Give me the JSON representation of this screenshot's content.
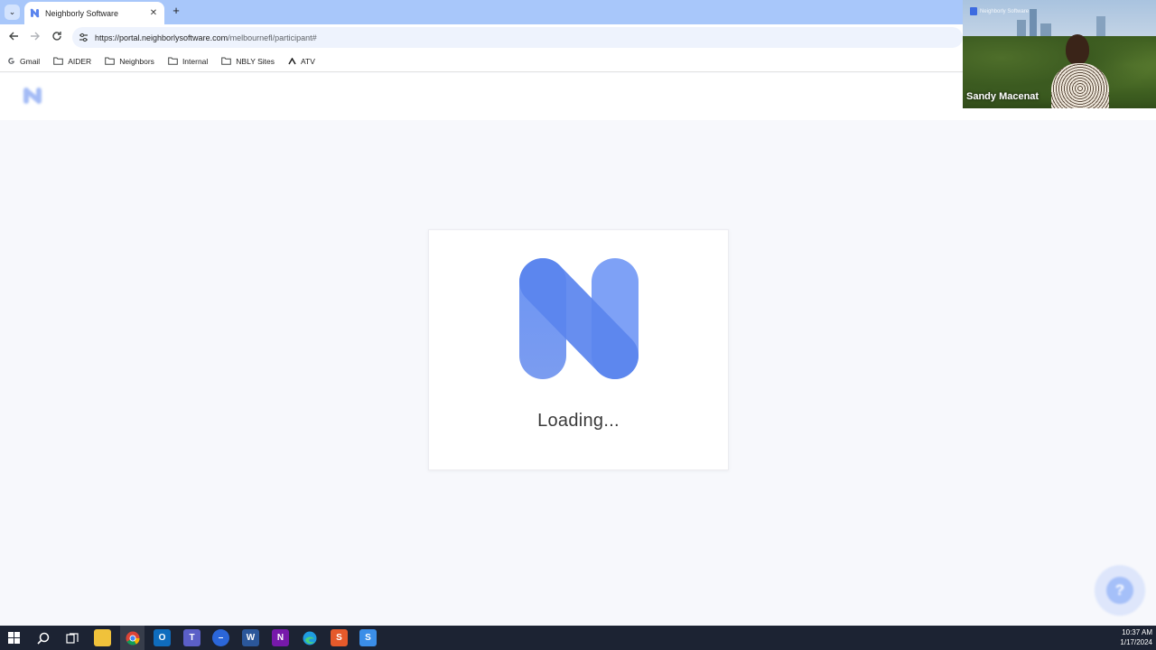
{
  "browser": {
    "tab_title": "Neighborly Software",
    "tab_close_glyph": "✕",
    "new_tab_glyph": "+",
    "url_host": "https://portal.neighborlysoftware.com",
    "url_path": "/melbournefl/participant#",
    "bookmarks": [
      {
        "label": "Gmail",
        "icon": "google-icon"
      },
      {
        "label": "AIDER",
        "icon": "folder-icon"
      },
      {
        "label": "Neighbors",
        "icon": "folder-icon"
      },
      {
        "label": "Internal",
        "icon": "folder-icon"
      },
      {
        "label": "NBLY Sites",
        "icon": "folder-icon"
      },
      {
        "label": "ATV",
        "icon": "atv-icon"
      }
    ]
  },
  "loading": {
    "text": "Loading..."
  },
  "video": {
    "participant_name": "Sandy Macenat",
    "watermark": "Neighborly Software"
  },
  "taskbar": {
    "icons": [
      "windows-start-icon",
      "search-icon",
      "task-view-icon",
      "file-explorer-icon",
      "chrome-icon",
      "outlook-icon",
      "teams-icon",
      "app-icon",
      "word-icon",
      "onenote-icon",
      "edge-icon",
      "snagit-icon",
      "app-s-icon"
    ],
    "time": "10:37 AM",
    "date": "1/17/2024"
  },
  "colors": {
    "brand_blue": "#5b85ee",
    "tabbar": "#a8c7fa",
    "taskbar": "#1c2333"
  }
}
